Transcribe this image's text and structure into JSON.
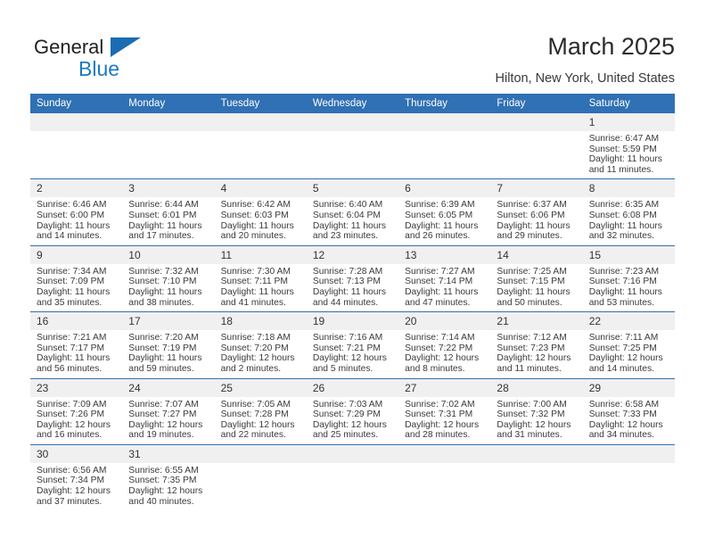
{
  "brand": {
    "name_part1": "General",
    "name_part2": "Blue",
    "triangle_color": "#1b6cb3",
    "blue_color": "#1b7ac2"
  },
  "header": {
    "title": "March 2025",
    "location": "Hilton, New York, United States"
  },
  "theme": {
    "header_bg": "#3070b4",
    "daynum_bg": "#f0f0f0",
    "row_border": "#3070b4"
  },
  "labels": {
    "sunrise_prefix": "Sunrise:",
    "sunset_prefix": "Sunset:",
    "daylight_prefix": "Daylight:"
  },
  "weekdays": [
    "Sunday",
    "Monday",
    "Tuesday",
    "Wednesday",
    "Thursday",
    "Friday",
    "Saturday"
  ],
  "weeks": [
    [
      {
        "day": "",
        "empty": true,
        "line1": "",
        "line2": "",
        "line3": "",
        "line4": ""
      },
      {
        "day": "",
        "empty": true,
        "line1": "",
        "line2": "",
        "line3": "",
        "line4": ""
      },
      {
        "day": "",
        "empty": true,
        "line1": "",
        "line2": "",
        "line3": "",
        "line4": ""
      },
      {
        "day": "",
        "empty": true,
        "line1": "",
        "line2": "",
        "line3": "",
        "line4": ""
      },
      {
        "day": "",
        "empty": true,
        "line1": "",
        "line2": "",
        "line3": "",
        "line4": ""
      },
      {
        "day": "",
        "empty": true,
        "line1": "",
        "line2": "",
        "line3": "",
        "line4": ""
      },
      {
        "day": "1",
        "empty": false,
        "line1": "Sunrise: 6:47 AM",
        "line2": "Sunset: 5:59 PM",
        "line3": "Daylight: 11 hours",
        "line4": "and 11 minutes."
      }
    ],
    [
      {
        "day": "2",
        "empty": false,
        "line1": "Sunrise: 6:46 AM",
        "line2": "Sunset: 6:00 PM",
        "line3": "Daylight: 11 hours",
        "line4": "and 14 minutes."
      },
      {
        "day": "3",
        "empty": false,
        "line1": "Sunrise: 6:44 AM",
        "line2": "Sunset: 6:01 PM",
        "line3": "Daylight: 11 hours",
        "line4": "and 17 minutes."
      },
      {
        "day": "4",
        "empty": false,
        "line1": "Sunrise: 6:42 AM",
        "line2": "Sunset: 6:03 PM",
        "line3": "Daylight: 11 hours",
        "line4": "and 20 minutes."
      },
      {
        "day": "5",
        "empty": false,
        "line1": "Sunrise: 6:40 AM",
        "line2": "Sunset: 6:04 PM",
        "line3": "Daylight: 11 hours",
        "line4": "and 23 minutes."
      },
      {
        "day": "6",
        "empty": false,
        "line1": "Sunrise: 6:39 AM",
        "line2": "Sunset: 6:05 PM",
        "line3": "Daylight: 11 hours",
        "line4": "and 26 minutes."
      },
      {
        "day": "7",
        "empty": false,
        "line1": "Sunrise: 6:37 AM",
        "line2": "Sunset: 6:06 PM",
        "line3": "Daylight: 11 hours",
        "line4": "and 29 minutes."
      },
      {
        "day": "8",
        "empty": false,
        "line1": "Sunrise: 6:35 AM",
        "line2": "Sunset: 6:08 PM",
        "line3": "Daylight: 11 hours",
        "line4": "and 32 minutes."
      }
    ],
    [
      {
        "day": "9",
        "empty": false,
        "line1": "Sunrise: 7:34 AM",
        "line2": "Sunset: 7:09 PM",
        "line3": "Daylight: 11 hours",
        "line4": "and 35 minutes."
      },
      {
        "day": "10",
        "empty": false,
        "line1": "Sunrise: 7:32 AM",
        "line2": "Sunset: 7:10 PM",
        "line3": "Daylight: 11 hours",
        "line4": "and 38 minutes."
      },
      {
        "day": "11",
        "empty": false,
        "line1": "Sunrise: 7:30 AM",
        "line2": "Sunset: 7:11 PM",
        "line3": "Daylight: 11 hours",
        "line4": "and 41 minutes."
      },
      {
        "day": "12",
        "empty": false,
        "line1": "Sunrise: 7:28 AM",
        "line2": "Sunset: 7:13 PM",
        "line3": "Daylight: 11 hours",
        "line4": "and 44 minutes."
      },
      {
        "day": "13",
        "empty": false,
        "line1": "Sunrise: 7:27 AM",
        "line2": "Sunset: 7:14 PM",
        "line3": "Daylight: 11 hours",
        "line4": "and 47 minutes."
      },
      {
        "day": "14",
        "empty": false,
        "line1": "Sunrise: 7:25 AM",
        "line2": "Sunset: 7:15 PM",
        "line3": "Daylight: 11 hours",
        "line4": "and 50 minutes."
      },
      {
        "day": "15",
        "empty": false,
        "line1": "Sunrise: 7:23 AM",
        "line2": "Sunset: 7:16 PM",
        "line3": "Daylight: 11 hours",
        "line4": "and 53 minutes."
      }
    ],
    [
      {
        "day": "16",
        "empty": false,
        "line1": "Sunrise: 7:21 AM",
        "line2": "Sunset: 7:17 PM",
        "line3": "Daylight: 11 hours",
        "line4": "and 56 minutes."
      },
      {
        "day": "17",
        "empty": false,
        "line1": "Sunrise: 7:20 AM",
        "line2": "Sunset: 7:19 PM",
        "line3": "Daylight: 11 hours",
        "line4": "and 59 minutes."
      },
      {
        "day": "18",
        "empty": false,
        "line1": "Sunrise: 7:18 AM",
        "line2": "Sunset: 7:20 PM",
        "line3": "Daylight: 12 hours",
        "line4": "and 2 minutes."
      },
      {
        "day": "19",
        "empty": false,
        "line1": "Sunrise: 7:16 AM",
        "line2": "Sunset: 7:21 PM",
        "line3": "Daylight: 12 hours",
        "line4": "and 5 minutes."
      },
      {
        "day": "20",
        "empty": false,
        "line1": "Sunrise: 7:14 AM",
        "line2": "Sunset: 7:22 PM",
        "line3": "Daylight: 12 hours",
        "line4": "and 8 minutes."
      },
      {
        "day": "21",
        "empty": false,
        "line1": "Sunrise: 7:12 AM",
        "line2": "Sunset: 7:23 PM",
        "line3": "Daylight: 12 hours",
        "line4": "and 11 minutes."
      },
      {
        "day": "22",
        "empty": false,
        "line1": "Sunrise: 7:11 AM",
        "line2": "Sunset: 7:25 PM",
        "line3": "Daylight: 12 hours",
        "line4": "and 14 minutes."
      }
    ],
    [
      {
        "day": "23",
        "empty": false,
        "line1": "Sunrise: 7:09 AM",
        "line2": "Sunset: 7:26 PM",
        "line3": "Daylight: 12 hours",
        "line4": "and 16 minutes."
      },
      {
        "day": "24",
        "empty": false,
        "line1": "Sunrise: 7:07 AM",
        "line2": "Sunset: 7:27 PM",
        "line3": "Daylight: 12 hours",
        "line4": "and 19 minutes."
      },
      {
        "day": "25",
        "empty": false,
        "line1": "Sunrise: 7:05 AM",
        "line2": "Sunset: 7:28 PM",
        "line3": "Daylight: 12 hours",
        "line4": "and 22 minutes."
      },
      {
        "day": "26",
        "empty": false,
        "line1": "Sunrise: 7:03 AM",
        "line2": "Sunset: 7:29 PM",
        "line3": "Daylight: 12 hours",
        "line4": "and 25 minutes."
      },
      {
        "day": "27",
        "empty": false,
        "line1": "Sunrise: 7:02 AM",
        "line2": "Sunset: 7:31 PM",
        "line3": "Daylight: 12 hours",
        "line4": "and 28 minutes."
      },
      {
        "day": "28",
        "empty": false,
        "line1": "Sunrise: 7:00 AM",
        "line2": "Sunset: 7:32 PM",
        "line3": "Daylight: 12 hours",
        "line4": "and 31 minutes."
      },
      {
        "day": "29",
        "empty": false,
        "line1": "Sunrise: 6:58 AM",
        "line2": "Sunset: 7:33 PM",
        "line3": "Daylight: 12 hours",
        "line4": "and 34 minutes."
      }
    ],
    [
      {
        "day": "30",
        "empty": false,
        "line1": "Sunrise: 6:56 AM",
        "line2": "Sunset: 7:34 PM",
        "line3": "Daylight: 12 hours",
        "line4": "and 37 minutes."
      },
      {
        "day": "31",
        "empty": false,
        "line1": "Sunrise: 6:55 AM",
        "line2": "Sunset: 7:35 PM",
        "line3": "Daylight: 12 hours",
        "line4": "and 40 minutes."
      },
      {
        "day": "",
        "empty": true,
        "line1": "",
        "line2": "",
        "line3": "",
        "line4": ""
      },
      {
        "day": "",
        "empty": true,
        "line1": "",
        "line2": "",
        "line3": "",
        "line4": ""
      },
      {
        "day": "",
        "empty": true,
        "line1": "",
        "line2": "",
        "line3": "",
        "line4": ""
      },
      {
        "day": "",
        "empty": true,
        "line1": "",
        "line2": "",
        "line3": "",
        "line4": ""
      },
      {
        "day": "",
        "empty": true,
        "line1": "",
        "line2": "",
        "line3": "",
        "line4": ""
      }
    ]
  ]
}
